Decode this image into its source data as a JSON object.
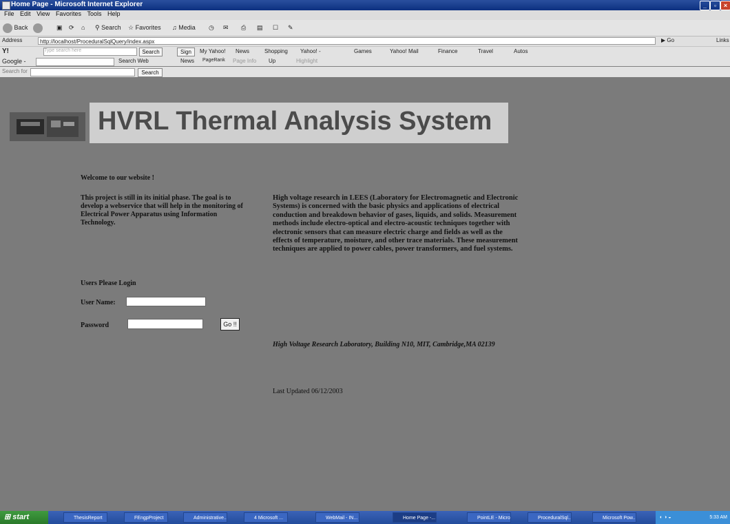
{
  "window": {
    "title": "Home Page - Microsoft Internet Explorer",
    "menu": [
      "File",
      "Edit",
      "View",
      "Favorites",
      "Tools",
      "Help"
    ]
  },
  "toolbar": {
    "back_label": "Back",
    "search_label": "Search",
    "favorites_label": "Favorites",
    "media_label": "Media"
  },
  "addressbar": {
    "label": "Address",
    "url": "http://localhost/ProceduralSqlQuery/index.aspx",
    "go_label": "Go",
    "links_label": "Links"
  },
  "yahoobar": {
    "search_placeholder": "Type search here",
    "search_button": "Search",
    "signin_button": "Sign In",
    "items": [
      "My Yahoo!",
      "News",
      "Shopping",
      "Yahoo! -",
      "Games",
      "Yahoo! Mail",
      "Finance",
      "Travel",
      "Autos"
    ]
  },
  "googlebar": {
    "label": "Google -",
    "search_web": "Search Web",
    "items": [
      "News",
      "PageRank",
      "Page Info",
      "Up",
      "Highlight"
    ]
  },
  "searchbar": {
    "label": "Search for",
    "button": "Search"
  },
  "page": {
    "banner_title": "HVRL Thermal Analysis System",
    "welcome": "Welcome to our website !",
    "intro": "This project is still in its initial phase. The goal is to develop a webservice that will help in the monitoring of Electrical Power Apparatus using Information Technology.",
    "login_heading": "Users Please Login",
    "user_label": "User Name:",
    "password_label": "Password",
    "go_button": "Go !!",
    "description": "High voltage research in LEES (Laboratory for Electromagnetic and Electronic Systems) is concerned with the basic physics and applications of electrical conduction and breakdown behavior of gases, liquids, and solids. Measurement methods include electro-optical and electro-acoustic techniques together with electronic sensors that can measure electric charge and fields as well as the effects of temperature, moisture, and other trace materials. These measurement techniques are applied to power cables, power transformers, and fuel systems.",
    "address": "High Voltage Research Laboratory, Building N10, MIT, Cambridge,MA 02139",
    "last_updated": "Last Updated 06/12/2003"
  },
  "taskbar": {
    "start": "start",
    "tasks": [
      "ThesisReport",
      "FEngpProject",
      "Administrative...",
      "4 Microsoft ...",
      "WebMail - IN...",
      "Home Page -...",
      "PointLE - Micro...",
      "ProceduralSql...",
      "Microsoft Pow..."
    ],
    "clock": "5:33 AM"
  }
}
